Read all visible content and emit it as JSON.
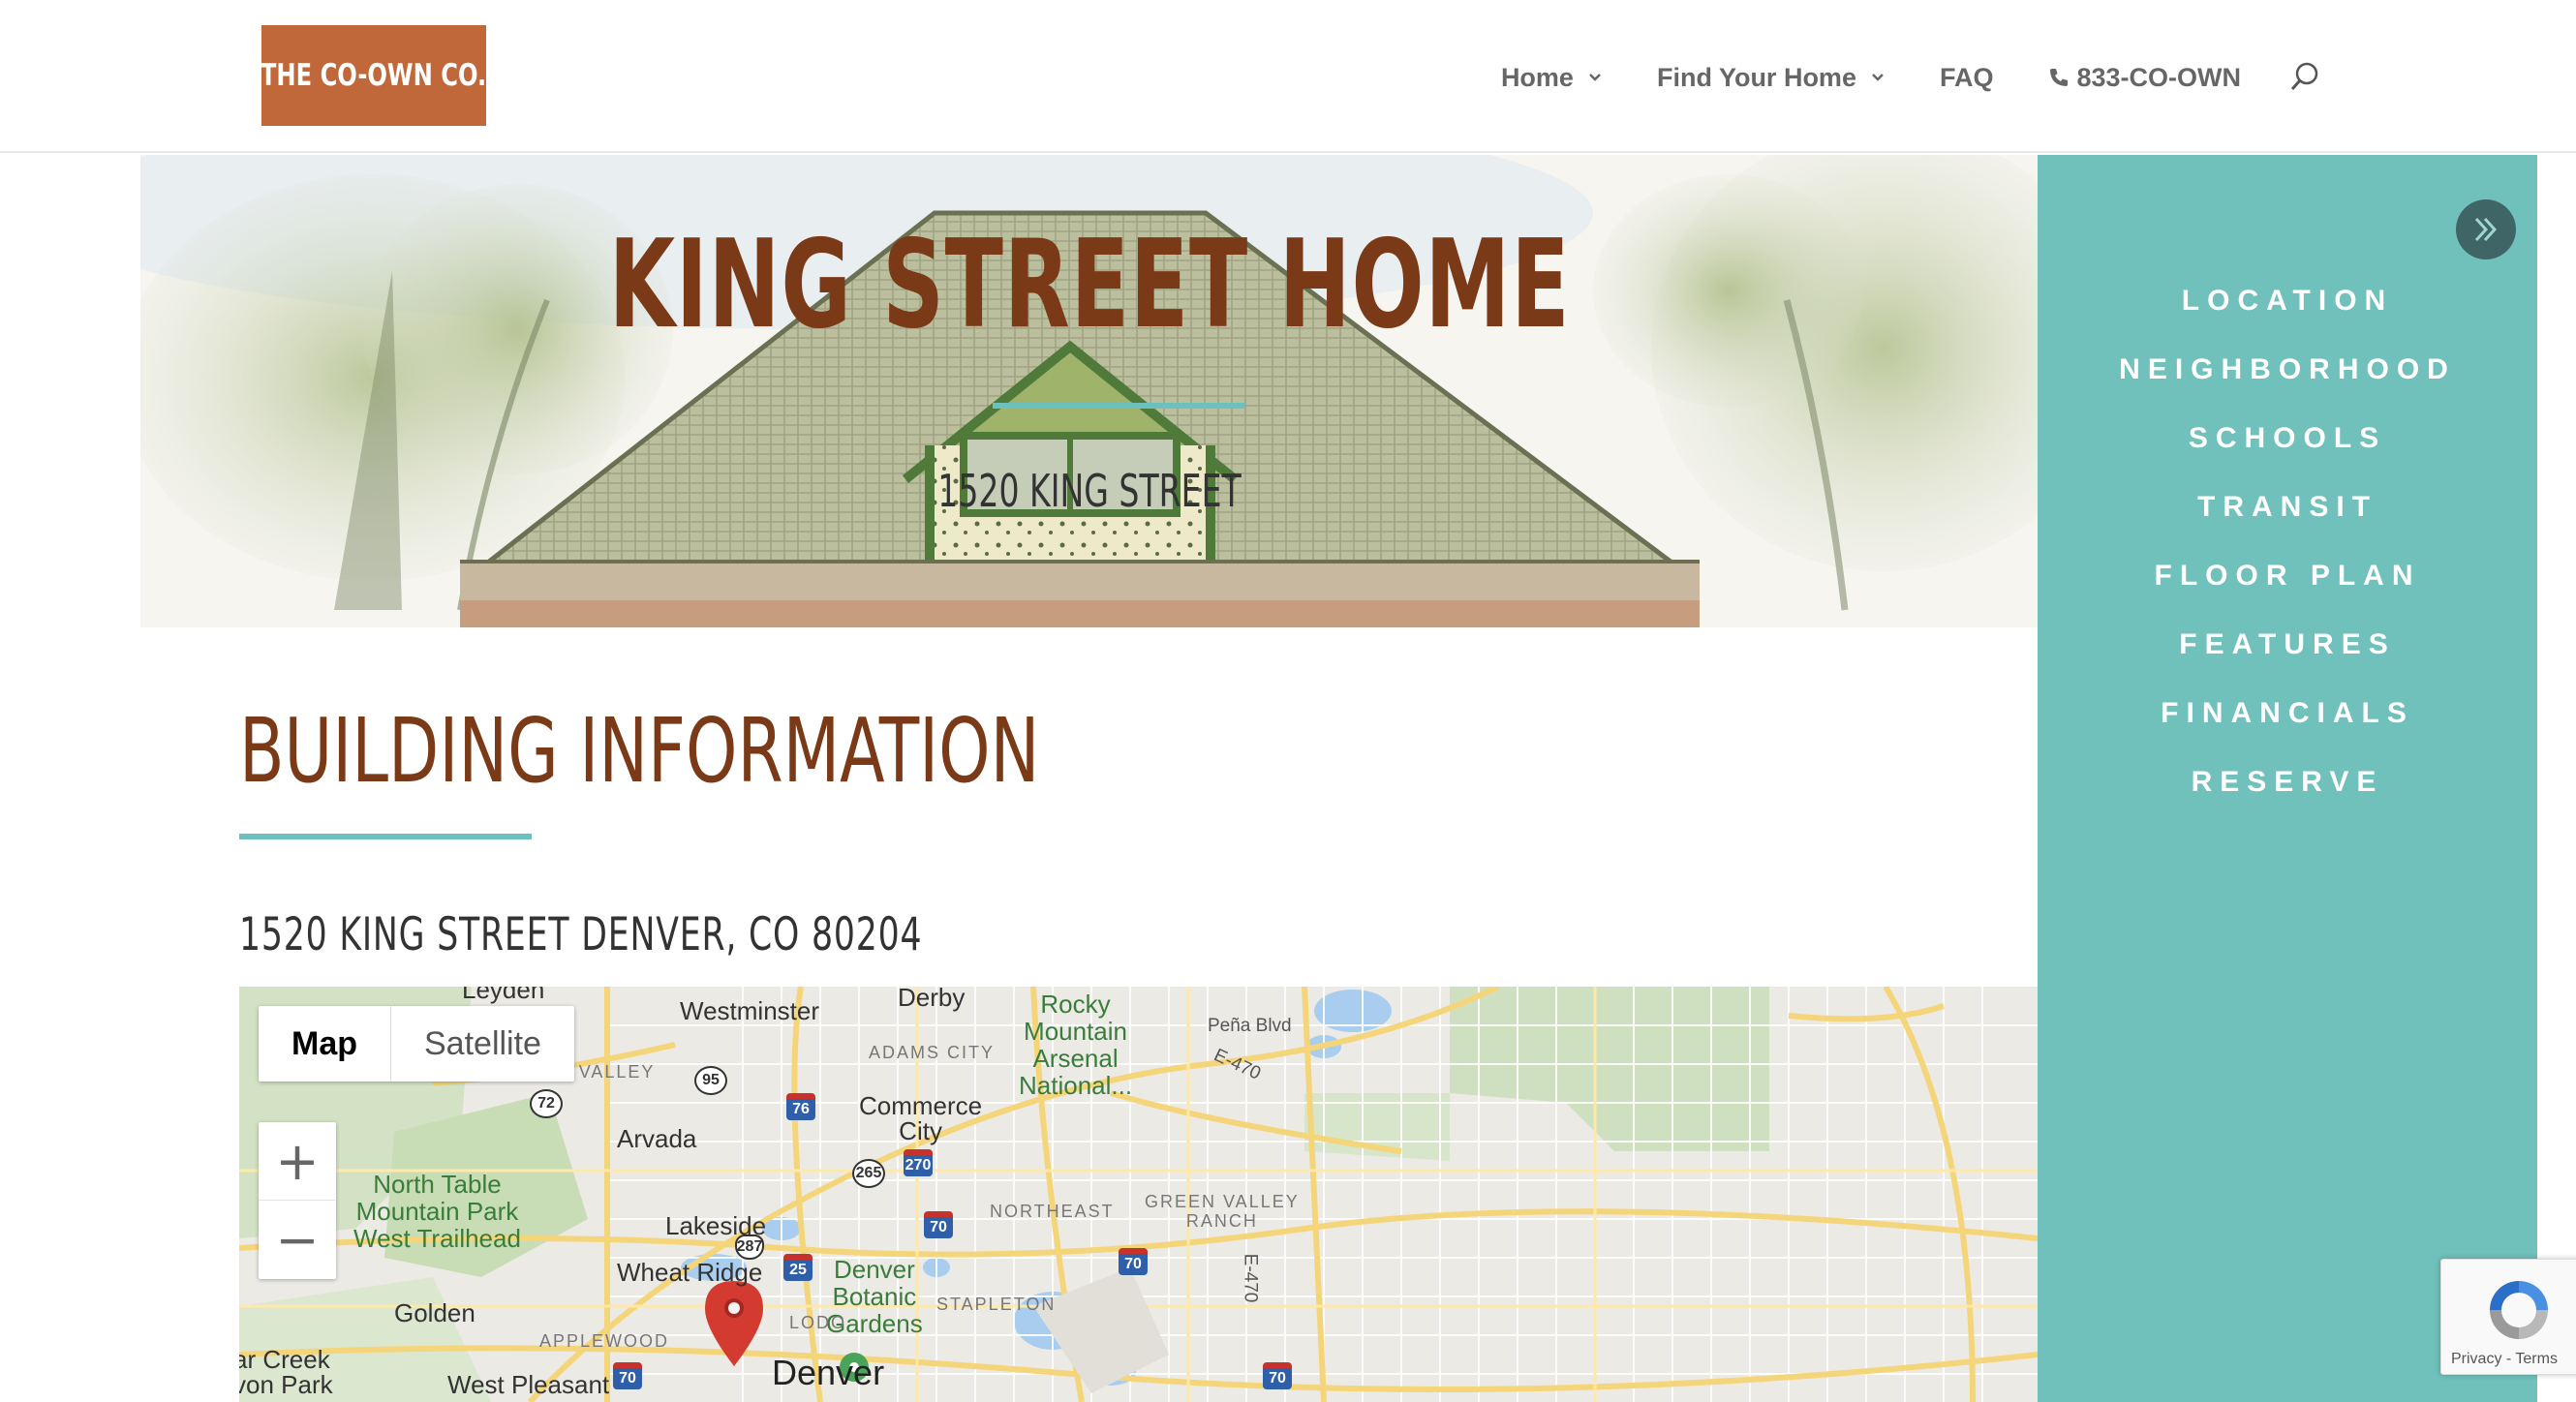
{
  "header": {
    "logo_text": "THE CO-OWN CO.",
    "nav": [
      {
        "label": "Home",
        "has_dropdown": true
      },
      {
        "label": "Find Your Home",
        "has_dropdown": true
      },
      {
        "label": "FAQ",
        "has_dropdown": false
      }
    ],
    "phone": "833-CO-OWN",
    "search_icon": "search-icon"
  },
  "hero": {
    "title": "KING STREET HOME",
    "subtitle": "1520 KING STREET"
  },
  "side_panel": {
    "toggle_icon": "double-chevron-right-icon",
    "links": [
      "LOCATION",
      "NEIGHBORHOOD",
      "SCHOOLS",
      "TRANSIT",
      "FLOOR PLAN",
      "FEATURES",
      "FINANCIALS",
      "RESERVE"
    ]
  },
  "content": {
    "section_title": "BUILDING INFORMATION",
    "address": "1520 KING STREET DENVER, CO 80204"
  },
  "map": {
    "type_controls": {
      "map": "Map",
      "satellite": "Satellite",
      "selected": "Map"
    },
    "zoom_in": "+",
    "zoom_out": "−",
    "labels": {
      "leyden": "Leyden",
      "westminster": "Westminster",
      "derby": "Derby",
      "rocky_mountain": "Rocky\nMountain\nArsenal\nNational...",
      "pena": "Peña Blvd",
      "e470": "E-470",
      "ralston": "RALSTON VALLEY",
      "adams_city": "ADAMS CITY",
      "arvada": "Arvada",
      "commerce_city": "Commerce\nCity",
      "north_table": "North Table\nMountain Park\nWest Trailhead",
      "lakeside": "Lakeside",
      "northeast": "NORTHEAST",
      "green_valley": "GREEN VALLEY\nRANCH",
      "wheat_ridge": "Wheat Ridge",
      "denver_botanic": "Denver\nBotanic\nGardens",
      "golden": "Golden",
      "stapleton": "STAPLETON",
      "lodo": "LODO",
      "applewood": "APPLEWOOD",
      "bear_creek": "ar Creek\nvon Park",
      "west_pleasant": "West Pleasant",
      "denver": "Denver",
      "e470_v": "E-470"
    },
    "shields": {
      "s95": "95",
      "s72": "72",
      "s76": "76",
      "s265": "265",
      "s270": "270",
      "s70a": "70",
      "s70b": "70",
      "s70c": "70",
      "s70d": "70",
      "s287": "287",
      "s25": "25"
    }
  },
  "recaptcha": {
    "terms": "Privacy - Terms"
  },
  "colors": {
    "brand_orange": "#c0683a",
    "title_brown": "#7b3a17",
    "teal": "#70c0bb",
    "teal_rule": "#6cc0bd"
  }
}
